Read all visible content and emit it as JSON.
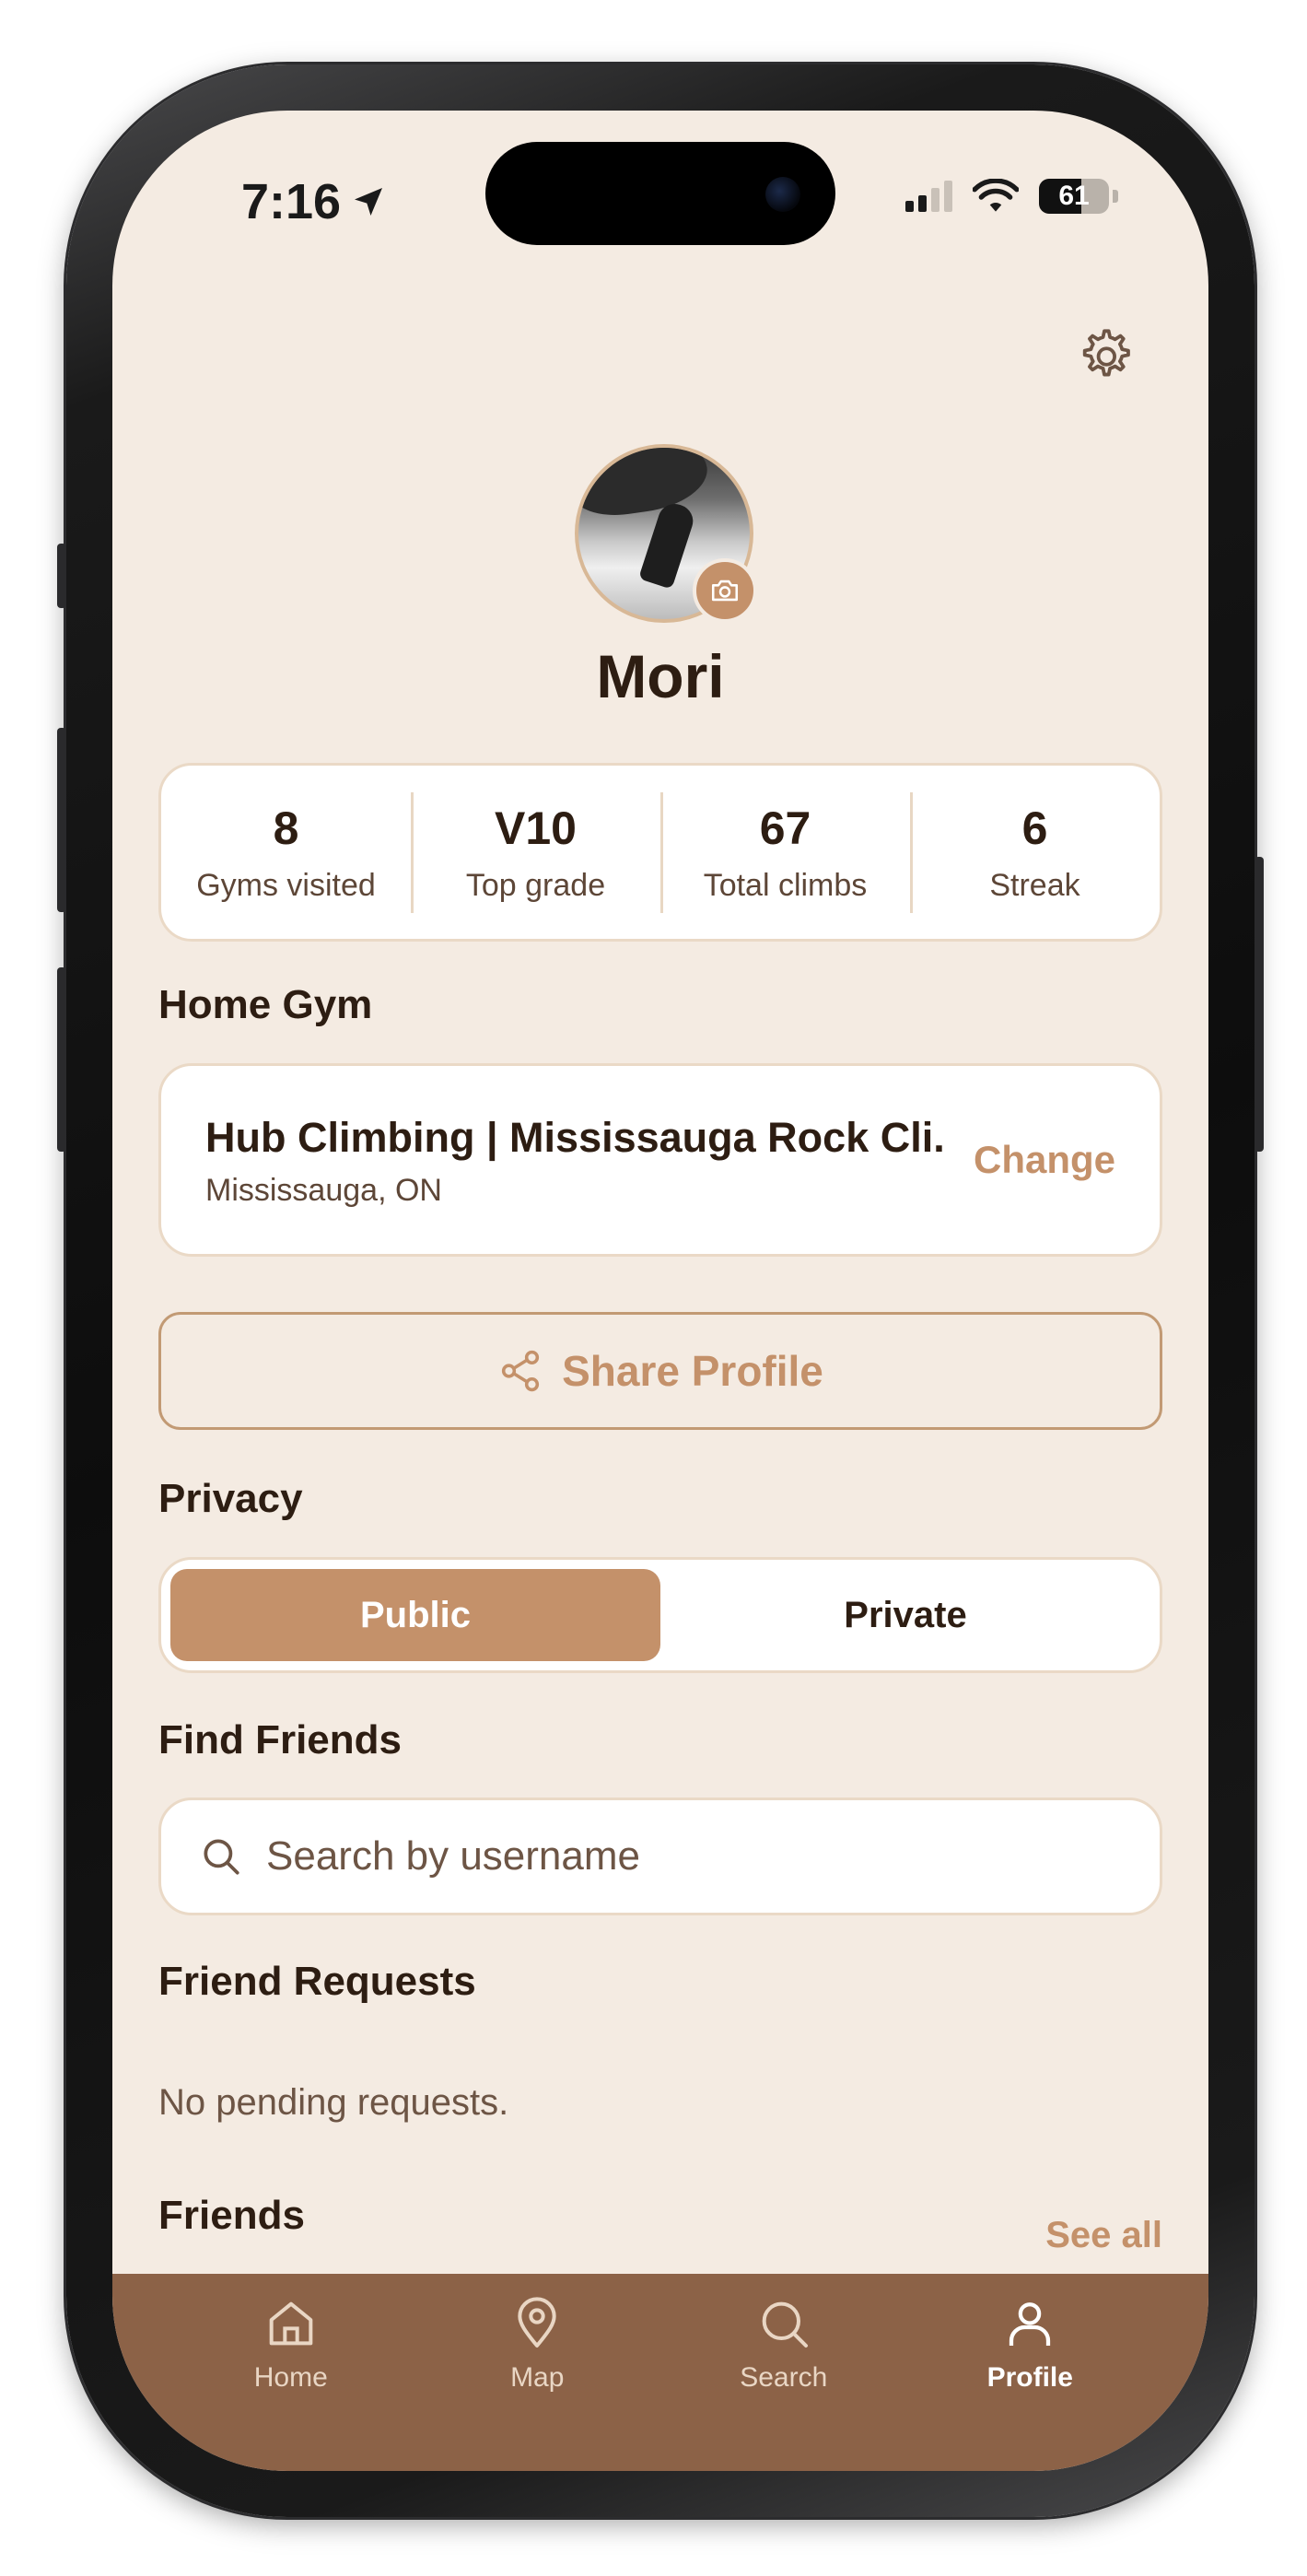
{
  "status_bar": {
    "time": "7:16",
    "battery": "61"
  },
  "profile": {
    "username": "Mori",
    "avatar_alt": "profile-photo"
  },
  "stats": [
    {
      "value": "8",
      "label": "Gyms visited"
    },
    {
      "value": "V10",
      "label": "Top grade"
    },
    {
      "value": "67",
      "label": "Total climbs"
    },
    {
      "value": "6",
      "label": "Streak"
    }
  ],
  "home_gym": {
    "title": "Home Gym",
    "name": "Hub Climbing | Mississauga Rock Cli...",
    "location": "Mississauga, ON",
    "change_label": "Change"
  },
  "share": {
    "label": "Share Profile"
  },
  "privacy": {
    "title": "Privacy",
    "options": [
      "Public",
      "Private"
    ],
    "selected": "Public"
  },
  "find_friends": {
    "title": "Find Friends",
    "placeholder": "Search by username"
  },
  "friend_requests": {
    "title": "Friend Requests",
    "empty_text": "No pending requests."
  },
  "friends": {
    "title": "Friends",
    "see_all_label": "See all"
  },
  "tabbar": {
    "tabs": [
      {
        "label": "Home",
        "icon": "home-icon"
      },
      {
        "label": "Map",
        "icon": "map-pin-icon"
      },
      {
        "label": "Search",
        "icon": "search-icon"
      },
      {
        "label": "Profile",
        "icon": "person-icon"
      }
    ],
    "active": "Profile"
  },
  "colors": {
    "background": "#f4ebe2",
    "accent": "#c4916a",
    "tabbar": "#8c6247",
    "text": "#2d1d12"
  }
}
